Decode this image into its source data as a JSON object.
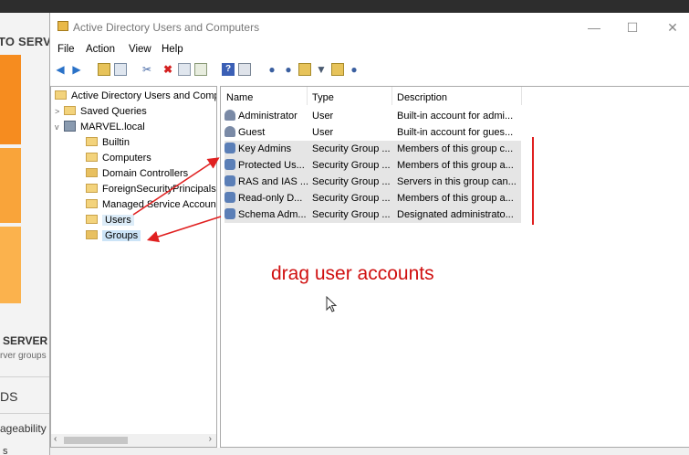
{
  "colors": {
    "accent": "#cce4f7",
    "annotation": "#e02020",
    "tile_orange": "#f68c1f"
  },
  "background": {
    "title": "TO SERVE",
    "server_heading": "SERVER",
    "server_sub": "rver groups",
    "ds": "DS",
    "manageability": "ageability",
    "bottom": "s"
  },
  "window": {
    "title": "Active Directory Users and Computers",
    "minimize": "—",
    "maximize": "☐",
    "close": "✕"
  },
  "menu": [
    "File",
    "Action",
    "View",
    "Help"
  ],
  "toolbar_icons": [
    "back-icon",
    "forward-icon",
    "up-folder-icon",
    "show-tree-icon",
    "cut-icon",
    "delete-icon",
    "properties-icon",
    "export-icon",
    "help-icon",
    "console-icon",
    "new-user-icon",
    "new-group-icon",
    "new-ou-icon",
    "filter-icon",
    "find-icon",
    "add-to-group-icon"
  ],
  "tree": {
    "root": "Active Directory Users and Comp",
    "saved_queries": "Saved Queries",
    "domain": "MARVEL.local",
    "children": [
      "Builtin",
      "Computers",
      "Domain Controllers",
      "ForeignSecurityPrincipals",
      "Managed Service Accoun",
      "Users",
      "Groups"
    ]
  },
  "columns": [
    "Name",
    "Type",
    "Description"
  ],
  "rows": [
    {
      "name": "Administrator",
      "type": "User",
      "desc": "Built-in account for admi..."
    },
    {
      "name": "Guest",
      "type": "User",
      "desc": "Built-in account for gues..."
    },
    {
      "name": "Key Admins",
      "type": "Security Group ...",
      "desc": "Members of this group c..."
    },
    {
      "name": "Protected Us...",
      "type": "Security Group ...",
      "desc": "Members of this group a..."
    },
    {
      "name": "RAS and IAS ...",
      "type": "Security Group ...",
      "desc": "Servers in this group can..."
    },
    {
      "name": "Read-only D...",
      "type": "Security Group ...",
      "desc": "Members of this group a..."
    },
    {
      "name": "Schema Adm...",
      "type": "Security Group ...",
      "desc": "Designated administrato..."
    }
  ],
  "annotation": {
    "text": "drag user accounts"
  }
}
